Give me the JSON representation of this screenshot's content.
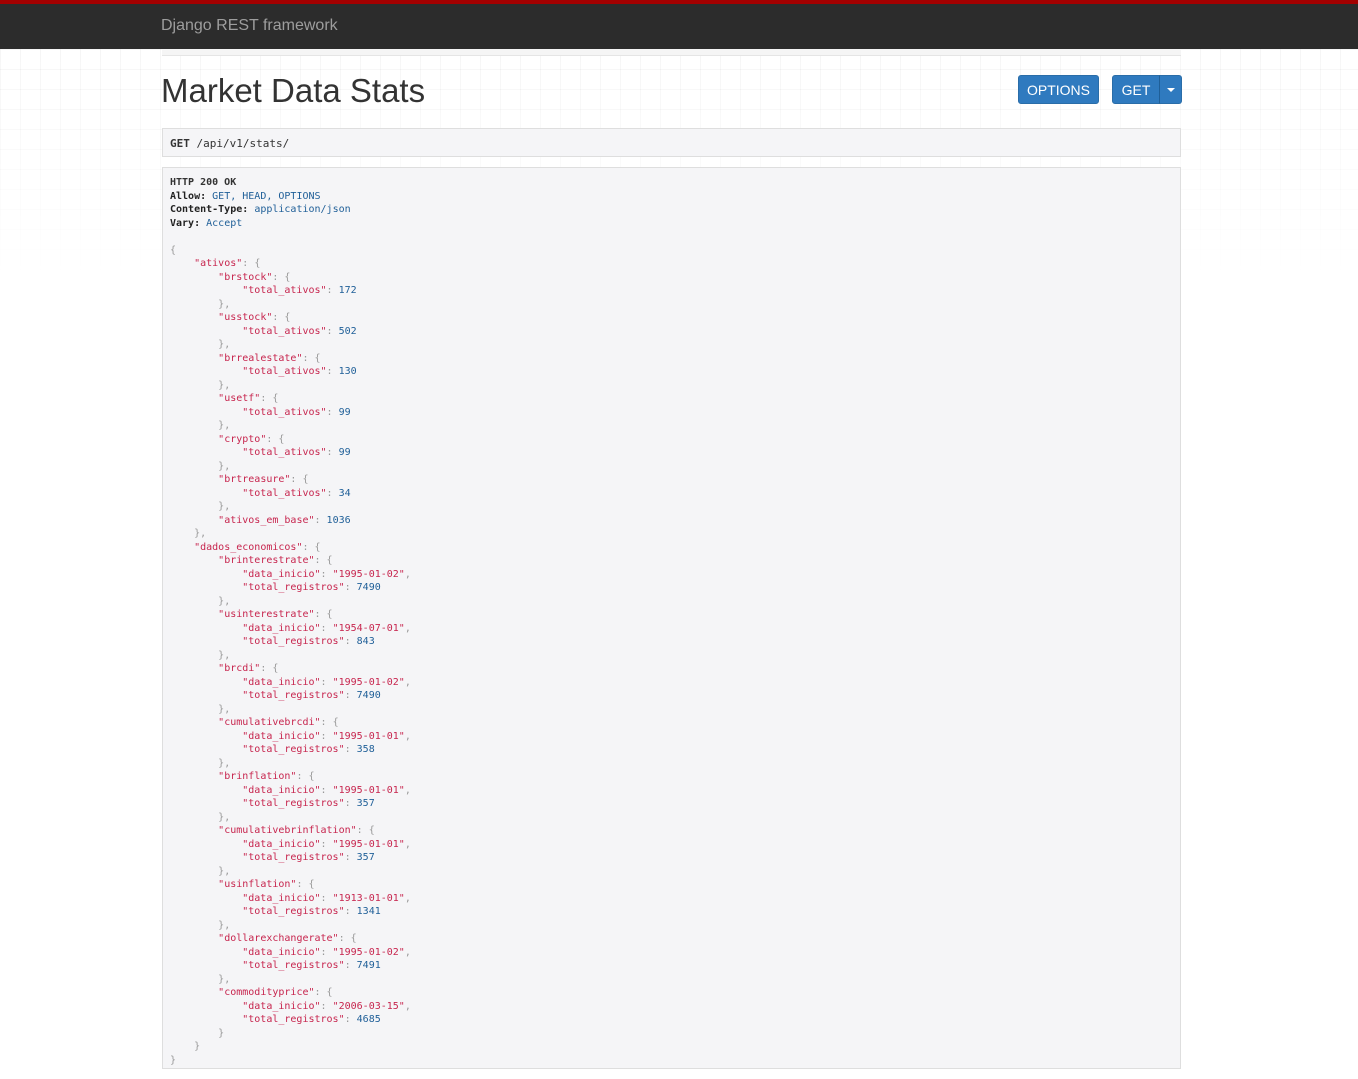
{
  "navbar": {
    "brand": "Django REST framework"
  },
  "page": {
    "title": "Market Data Stats"
  },
  "buttons": {
    "options": "OPTIONS",
    "get": "GET"
  },
  "request": {
    "method": "GET",
    "path": "/api/v1/stats/"
  },
  "response": {
    "status": "HTTP 200 OK",
    "headers": [
      {
        "name": "Allow:",
        "value": "GET, HEAD, OPTIONS"
      },
      {
        "name": "Content-Type:",
        "value": "application/json"
      },
      {
        "name": "Vary:",
        "value": "Accept"
      }
    ],
    "body": {
      "ativos": {
        "brstock": {
          "total_ativos": 172
        },
        "usstock": {
          "total_ativos": 502
        },
        "brrealestate": {
          "total_ativos": 130
        },
        "usetf": {
          "total_ativos": 99
        },
        "crypto": {
          "total_ativos": 99
        },
        "brtreasure": {
          "total_ativos": 34
        },
        "ativos_em_base": 1036
      },
      "dados_economicos": {
        "brinterestrate": {
          "data_inicio": "1995-01-02",
          "total_registros": 7490
        },
        "usinterestrate": {
          "data_inicio": "1954-07-01",
          "total_registros": 843
        },
        "brcdi": {
          "data_inicio": "1995-01-02",
          "total_registros": 7490
        },
        "cumulativebrcdi": {
          "data_inicio": "1995-01-01",
          "total_registros": 358
        },
        "brinflation": {
          "data_inicio": "1995-01-01",
          "total_registros": 357
        },
        "cumulativebrinflation": {
          "data_inicio": "1995-01-01",
          "total_registros": 357
        },
        "usinflation": {
          "data_inicio": "1913-01-01",
          "total_registros": 1341
        },
        "dollarexchangerate": {
          "data_inicio": "1995-01-02",
          "total_registros": 7491
        },
        "commodityprice": {
          "data_inicio": "2006-03-15",
          "total_registros": 4685
        }
      }
    }
  }
}
